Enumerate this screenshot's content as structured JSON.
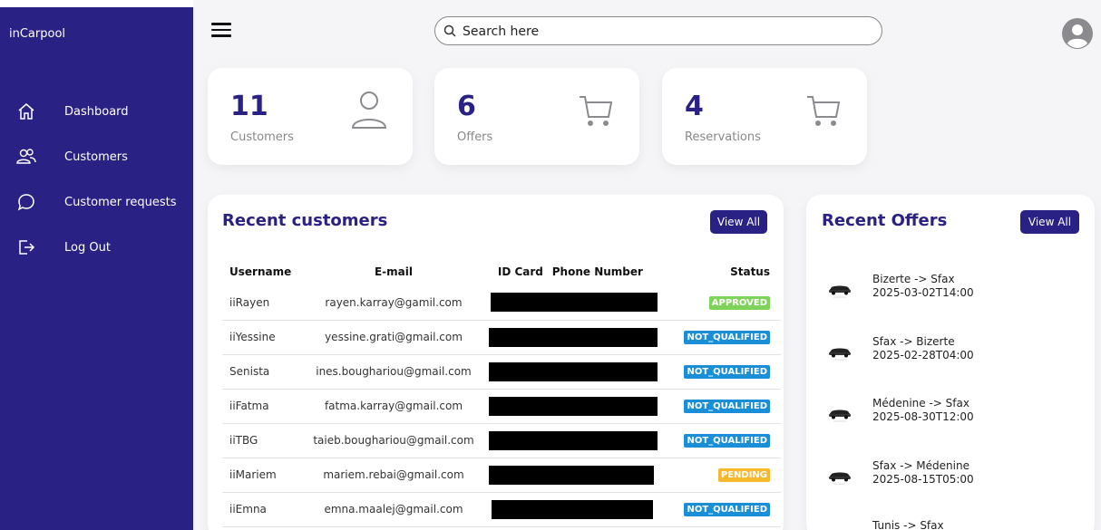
{
  "brand": "inCarpool",
  "sidebar": {
    "items": [
      {
        "label": "Dashboard",
        "icon": "home-icon"
      },
      {
        "label": "Customers",
        "icon": "users-icon"
      },
      {
        "label": "Customer requests",
        "icon": "chat-bubble-icon"
      },
      {
        "label": "Log Out",
        "icon": "logout-icon"
      }
    ]
  },
  "search": {
    "placeholder": "Search here"
  },
  "stats": [
    {
      "value": "11",
      "label": "Customers",
      "icon": "user-icon"
    },
    {
      "value": "6",
      "label": "Offers",
      "icon": "cart-icon"
    },
    {
      "value": "4",
      "label": "Reservations",
      "icon": "cart-icon"
    }
  ],
  "recent_customers": {
    "title": "Recent customers",
    "view_all": "View All",
    "headers": {
      "username": "Username",
      "email": "E-mail",
      "id_card": "ID Card",
      "phone": "Phone Number",
      "status": "Status"
    },
    "rows": [
      {
        "username": "iiRayen",
        "email": "rayen.karray@gamil.com",
        "status": "APPROVED"
      },
      {
        "username": "iiYessine",
        "email": "yessine.grati@gmail.com",
        "status": "NOT_QUALIFIED"
      },
      {
        "username": "Senista",
        "email": "ines.boughariou@gmail.com",
        "status": "NOT_QUALIFIED"
      },
      {
        "username": "iiFatma",
        "email": "fatma.karray@gmail.com",
        "status": "NOT_QUALIFIED"
      },
      {
        "username": "iiTBG",
        "email": "taieb.boughariou@gmail.com",
        "status": "NOT_QUALIFIED"
      },
      {
        "username": "iiMariem",
        "email": "mariem.rebai@gmail.com",
        "status": "PENDING"
      },
      {
        "username": "iiEmna",
        "email": "emna.maalej@gmail.com",
        "status": "NOT_QUALIFIED"
      }
    ]
  },
  "recent_offers": {
    "title": "Recent Offers",
    "view_all": "View All",
    "items": [
      {
        "route": "Bizerte -> Sfax",
        "date": "2025-03-02T14:00"
      },
      {
        "route": "Sfax -> Bizerte",
        "date": "2025-02-28T04:00"
      },
      {
        "route": "Médenine -> Sfax",
        "date": "2025-08-30T12:00"
      },
      {
        "route": "Sfax -> Médenine",
        "date": "2025-08-15T05:00"
      },
      {
        "route": "Tunis -> Sfax",
        "date": ""
      }
    ]
  },
  "colors": {
    "accent": "#2a2185",
    "approved": "#7fd35a",
    "not_qualified": "#1a8fd8",
    "pending": "#f5b82e"
  }
}
